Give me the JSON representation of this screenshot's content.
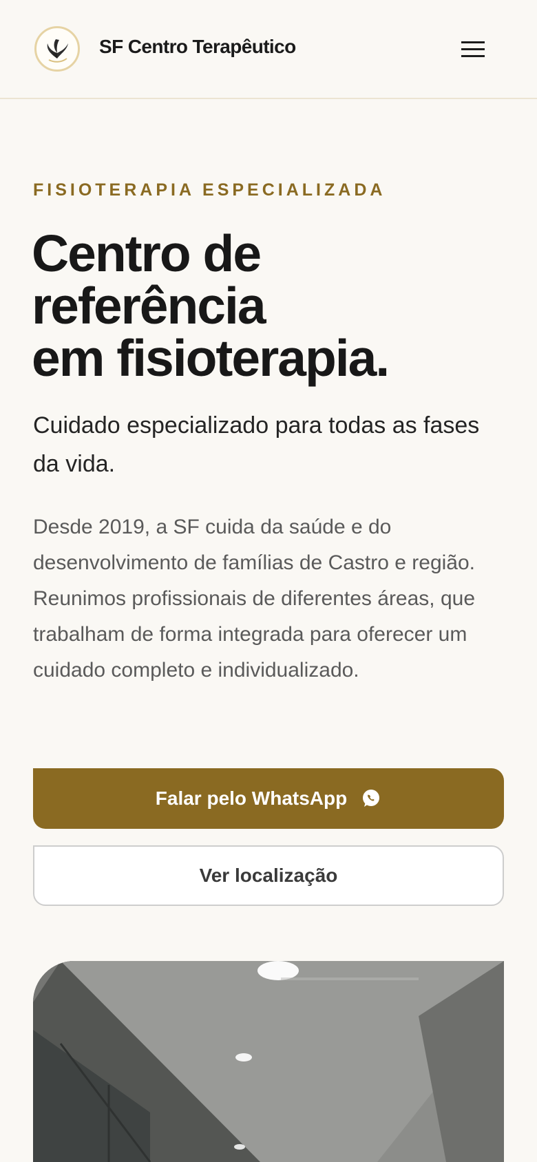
{
  "header": {
    "brand_name": "SF Centro Terapêutico",
    "logo_icon": "butterfly-logo",
    "menu_icon": "hamburger-menu-icon"
  },
  "hero": {
    "eyebrow": "FISIOTERAPIA ESPECIALIZADA",
    "title_lines": [
      "Centro de",
      "referência",
      "em fisioterapia."
    ],
    "subtitle": "Cuidado especializado para todas as fases da vida.",
    "description": "Desde 2019, a SF cuida da saúde e do desenvolvimento de famílias de Castro e região. Reunimos profissionais de diferentes áreas, que trabalham de forma integrada para oferecer um cuidado completo e individualizado.",
    "primary_button_label": "Falar pelo WhatsApp",
    "primary_button_icon": "whatsapp-icon",
    "secondary_button_label": "Ver localização"
  },
  "colors": {
    "accent": "#8a6a22",
    "background": "#faf8f4",
    "text": "#1c1c1c",
    "muted_text": "#5a5a5a"
  }
}
